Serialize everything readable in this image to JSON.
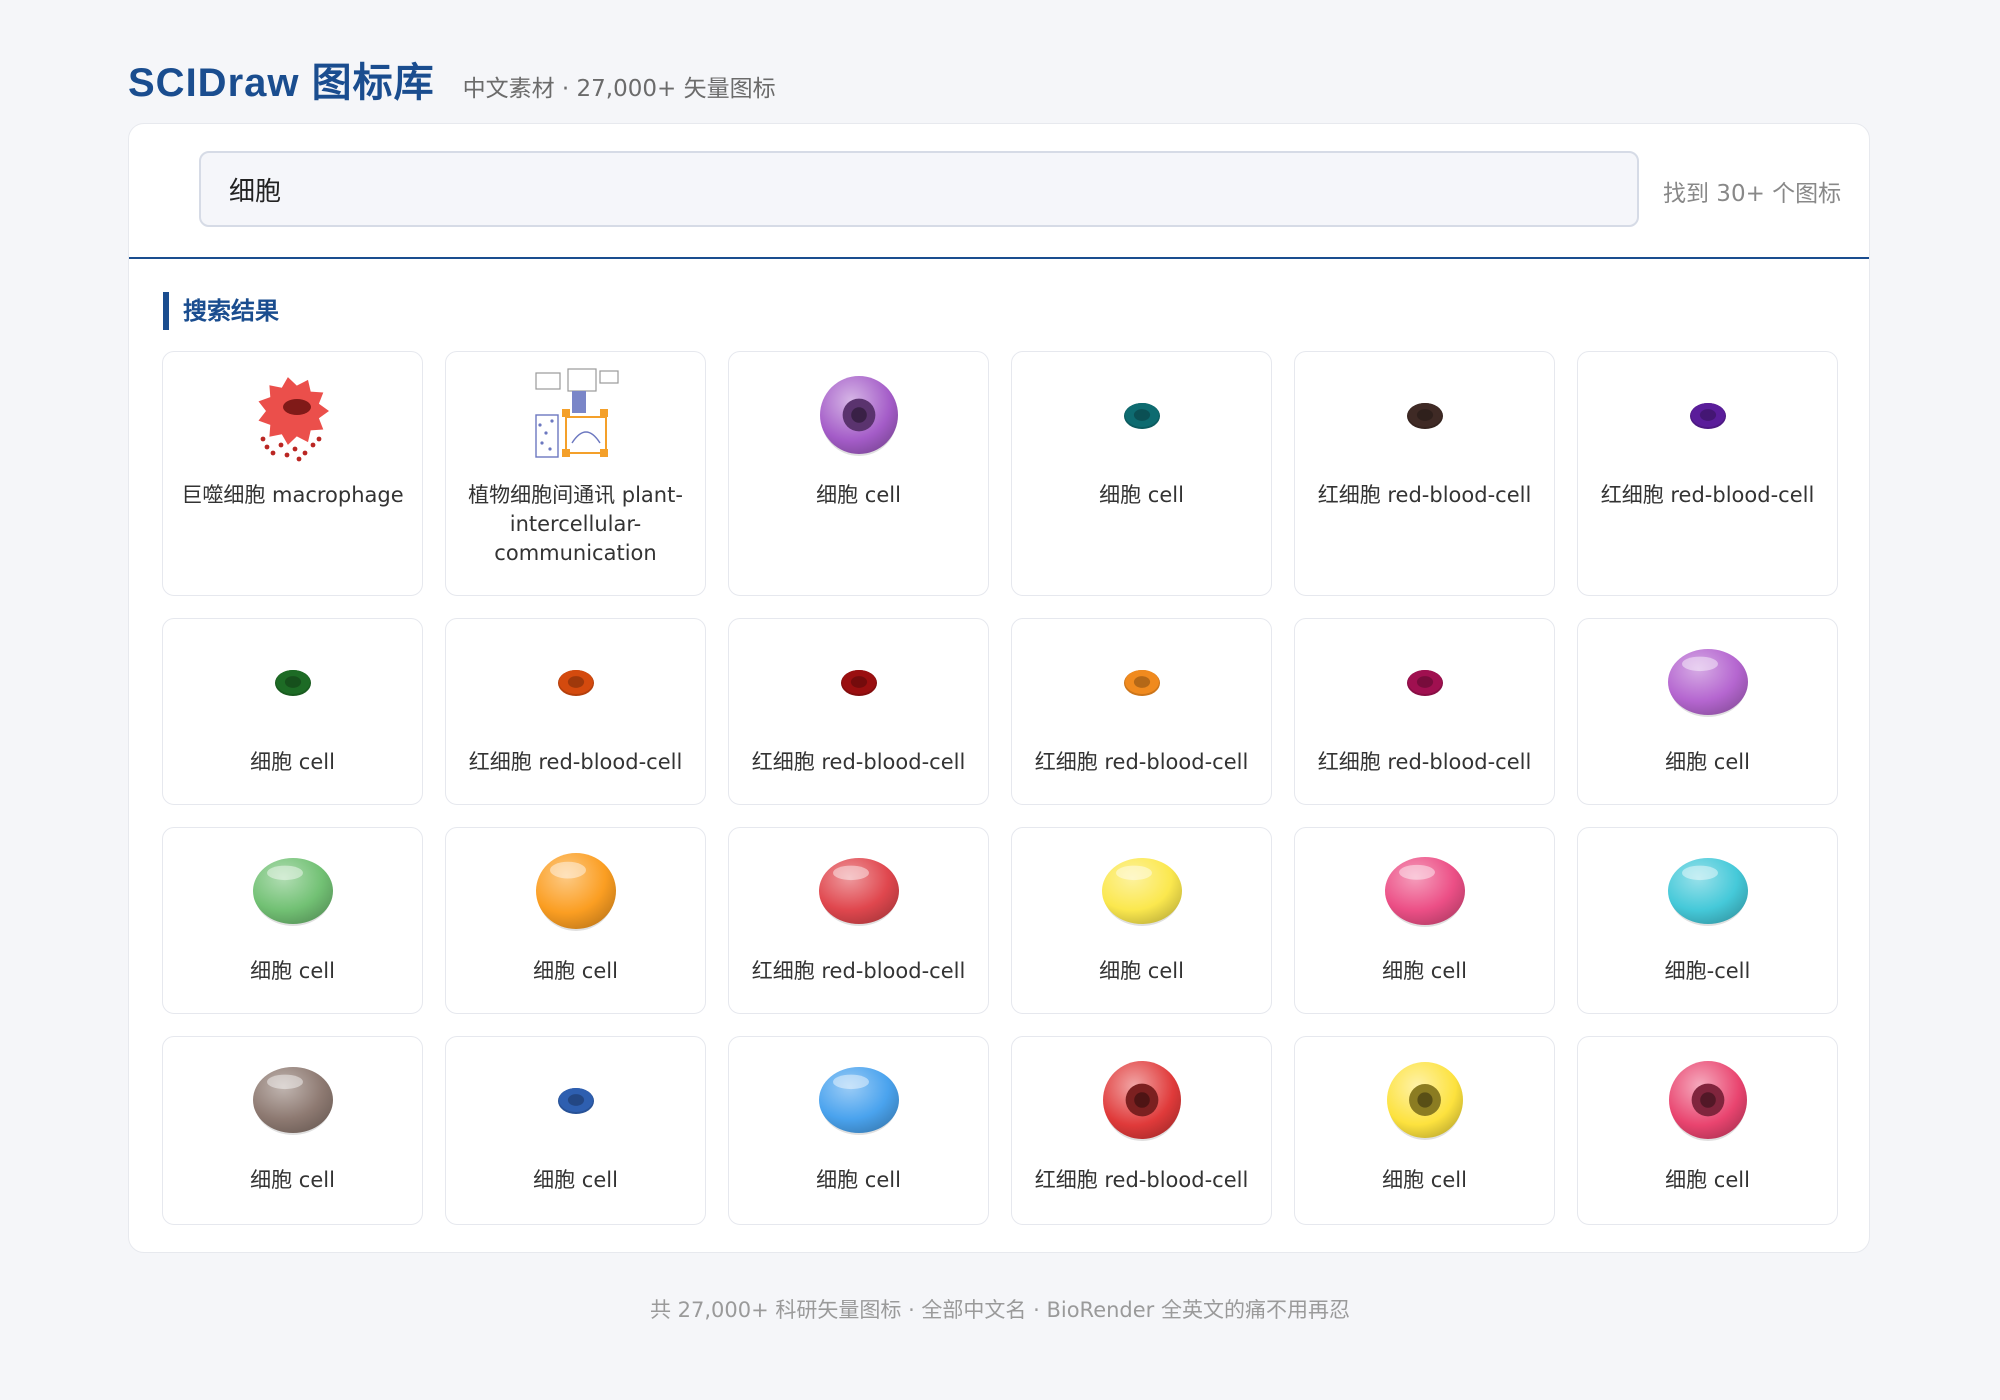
{
  "header": {
    "brand": "SCIDraw 图标库",
    "subtitle": "中文素材 · 27,000+ 矢量图标"
  },
  "search": {
    "query": "细胞",
    "result_count": "找到 30+ 个图标"
  },
  "section": {
    "title": "搜索结果"
  },
  "results": [
    {
      "label": "巨噬细胞 macrophage",
      "icon": "macrophage-icon",
      "color": "#e8302c"
    },
    {
      "label": "植物细胞间通讯 plant-intercellular-communication",
      "icon": "plant-intercellular-communication-icon",
      "color": "#f4a02a"
    },
    {
      "label": "细胞 cell",
      "icon": "cell-icon",
      "color": "#a45cc8"
    },
    {
      "label": "细胞 cell",
      "icon": "cell-icon",
      "color": "#0e6b70"
    },
    {
      "label": "红细胞 red-blood-cell",
      "icon": "red-blood-cell-icon",
      "color": "#3f2a25"
    },
    {
      "label": "红细胞 red-blood-cell",
      "icon": "red-blood-cell-icon",
      "color": "#5a1d9a"
    },
    {
      "label": "细胞 cell",
      "icon": "cell-icon",
      "color": "#1d6b25"
    },
    {
      "label": "红细胞 red-blood-cell",
      "icon": "red-blood-cell-icon",
      "color": "#d44a0e"
    },
    {
      "label": "红细胞 red-blood-cell",
      "icon": "red-blood-cell-icon",
      "color": "#9a0f10"
    },
    {
      "label": "红细胞 red-blood-cell",
      "icon": "red-blood-cell-icon",
      "color": "#f08a1e"
    },
    {
      "label": "红细胞 red-blood-cell",
      "icon": "red-blood-cell-icon",
      "color": "#a01050"
    },
    {
      "label": "细胞 cell",
      "icon": "cell-icon",
      "color": "#b566d0"
    },
    {
      "label": "细胞 cell",
      "icon": "cell-icon",
      "color": "#72c174"
    },
    {
      "label": "细胞 cell",
      "icon": "cell-icon",
      "color": "#fb9e22"
    },
    {
      "label": "红细胞 red-blood-cell",
      "icon": "red-blood-cell-icon",
      "color": "#e0474e"
    },
    {
      "label": "细胞 cell",
      "icon": "cell-icon",
      "color": "#fbe84e"
    },
    {
      "label": "细胞 cell",
      "icon": "cell-icon",
      "color": "#ec4f86"
    },
    {
      "label": "细胞-cell",
      "icon": "cell-icon",
      "color": "#45c9d9"
    },
    {
      "label": "细胞 cell",
      "icon": "cell-icon",
      "color": "#8e7a72"
    },
    {
      "label": "细胞 cell",
      "icon": "cell-icon",
      "color": "#2e5fb0"
    },
    {
      "label": "细胞 cell",
      "icon": "cell-icon",
      "color": "#4aa3ee"
    },
    {
      "label": "红细胞 red-blood-cell",
      "icon": "red-blood-cell-icon",
      "color": "#e03a3a"
    },
    {
      "label": "细胞 cell",
      "icon": "cell-icon",
      "color": "#fde23e"
    },
    {
      "label": "细胞 cell",
      "icon": "cell-icon",
      "color": "#e9446f"
    }
  ],
  "footer": {
    "text": "共 27,000+ 科研矢量图标 · 全部中文名 · BioRender 全英文的痛不用再忍"
  }
}
